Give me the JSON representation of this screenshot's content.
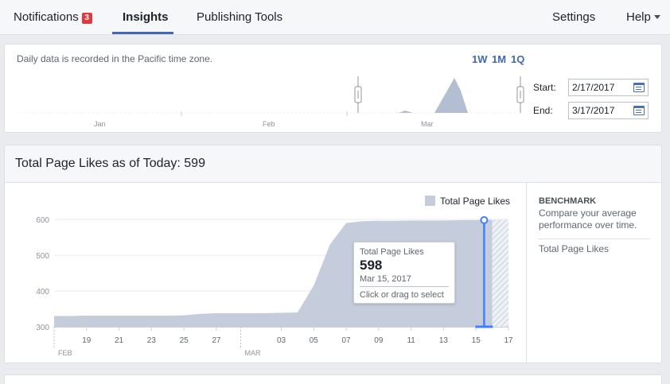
{
  "nav": {
    "tabs": [
      {
        "label": "Notifications",
        "badge": "3"
      },
      {
        "label": "Insights"
      },
      {
        "label": "Publishing Tools"
      }
    ],
    "right": [
      {
        "label": "Settings"
      },
      {
        "label": "Help"
      }
    ],
    "active": "Insights",
    "accent_color": "#4267b2",
    "badge_color": "#e0393e"
  },
  "range_selector": {
    "note": "Daily data is recorded in the Pacific time zone.",
    "quick_ranges": [
      "1W",
      "1M",
      "1Q"
    ],
    "start_label": "Start:",
    "start_value": "2/17/2017",
    "end_label": "End:",
    "end_value": "3/17/2017",
    "month_labels": [
      "Jan",
      "Feb",
      "Mar"
    ],
    "calendar_icon": "calendar-icon"
  },
  "page_likes": {
    "title": "Total Page Likes as of Today: 599",
    "legend_label": "Total Page Likes",
    "series_color": "#c5cddc",
    "selection_color": "#4080ff",
    "benchmark": {
      "title": "BENCHMARK",
      "description": "Compare your average performance over time.",
      "metric": "Total Page Likes"
    },
    "tooltip": {
      "title": "Total Page Likes",
      "value": "598",
      "date": "Mar 15, 2017",
      "action": "Click or drag to select"
    }
  },
  "chart_data": {
    "type": "area",
    "title": "",
    "xlabel": "",
    "ylabel": "",
    "ylim": [
      300,
      620
    ],
    "yticks": [
      300,
      400,
      500,
      600
    ],
    "series": [
      {
        "name": "Total Page Likes",
        "x": [
          "Feb 17",
          "Feb 18",
          "Feb 19",
          "Feb 20",
          "Feb 21",
          "Feb 22",
          "Feb 23",
          "Feb 24",
          "Feb 25",
          "Feb 26",
          "Feb 27",
          "Feb 28",
          "Mar 01",
          "Mar 02",
          "Mar 03",
          "Mar 04",
          "Mar 05",
          "Mar 06",
          "Mar 07",
          "Mar 08",
          "Mar 09",
          "Mar 10",
          "Mar 11",
          "Mar 12",
          "Mar 13",
          "Mar 14",
          "Mar 15",
          "Mar 16",
          "Mar 17"
        ],
        "values": [
          330,
          330,
          331,
          331,
          331,
          331,
          331,
          331,
          332,
          336,
          338,
          338,
          338,
          338,
          339,
          340,
          415,
          530,
          590,
          595,
          596,
          596,
          597,
          597,
          597,
          598,
          598,
          599,
          599
        ]
      }
    ],
    "x_tick_labels": [
      "19",
      "21",
      "23",
      "25",
      "27",
      "03",
      "05",
      "07",
      "09",
      "11",
      "13",
      "15",
      "17"
    ],
    "month_labels": [
      "FEB",
      "MAR"
    ],
    "selected": {
      "x": "Mar 15",
      "value": 598
    },
    "incomplete_region": "Mar 16 – Mar 17",
    "grid": true,
    "legend": "top-right"
  }
}
